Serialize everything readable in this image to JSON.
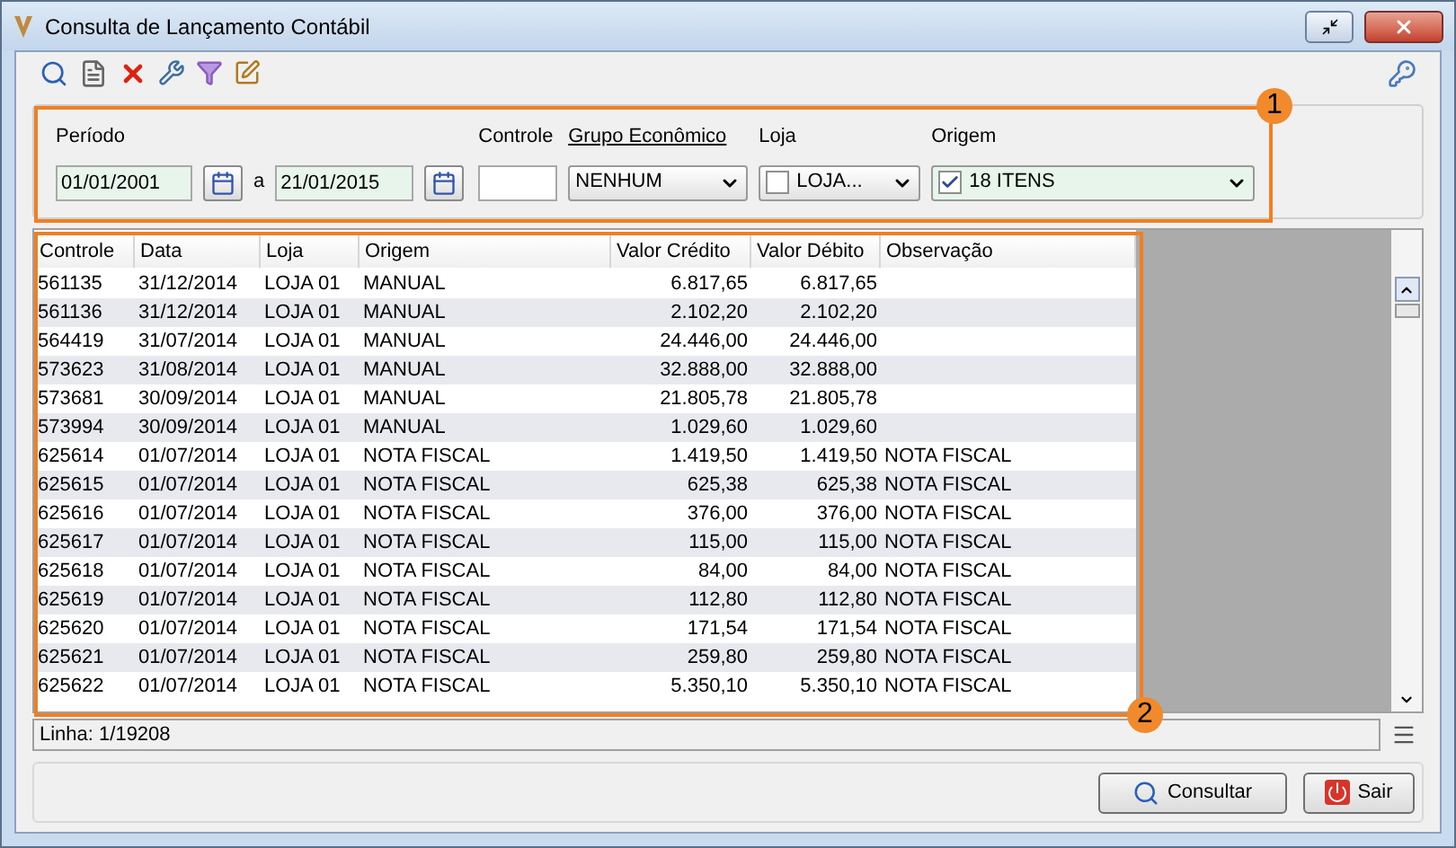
{
  "window": {
    "title": "Consulta de Lançamento Contábil"
  },
  "filters": {
    "period": {
      "label": "Período",
      "from": "01/01/2001",
      "separator": "a",
      "to": "21/01/2015"
    },
    "controle": {
      "label": "Controle"
    },
    "grupo": {
      "label": "Grupo Econômico",
      "value": "NENHUM"
    },
    "loja": {
      "label": "Loja",
      "checked": false,
      "value": "LOJA..."
    },
    "origem": {
      "label": "Origem",
      "checked": true,
      "value": "18 ITENS"
    }
  },
  "table": {
    "columns": [
      "Controle",
      "Data",
      "Loja",
      "Origem",
      "Valor Crédito",
      "Valor Débito",
      "Observação"
    ],
    "rows": [
      [
        "561135",
        "31/12/2014",
        "LOJA 01",
        "MANUAL",
        "6.817,65",
        "6.817,65",
        ""
      ],
      [
        "561136",
        "31/12/2014",
        "LOJA 01",
        "MANUAL",
        "2.102,20",
        "2.102,20",
        ""
      ],
      [
        "564419",
        "31/07/2014",
        "LOJA 01",
        "MANUAL",
        "24.446,00",
        "24.446,00",
        ""
      ],
      [
        "573623",
        "31/08/2014",
        "LOJA 01",
        "MANUAL",
        "32.888,00",
        "32.888,00",
        ""
      ],
      [
        "573681",
        "30/09/2014",
        "LOJA 01",
        "MANUAL",
        "21.805,78",
        "21.805,78",
        ""
      ],
      [
        "573994",
        "30/09/2014",
        "LOJA 01",
        "MANUAL",
        "1.029,60",
        "1.029,60",
        ""
      ],
      [
        "625614",
        "01/07/2014",
        "LOJA 01",
        "NOTA FISCAL",
        "1.419,50",
        "1.419,50",
        "NOTA FISCAL"
      ],
      [
        "625615",
        "01/07/2014",
        "LOJA 01",
        "NOTA FISCAL",
        "625,38",
        "625,38",
        "NOTA FISCAL"
      ],
      [
        "625616",
        "01/07/2014",
        "LOJA 01",
        "NOTA FISCAL",
        "376,00",
        "376,00",
        "NOTA FISCAL"
      ],
      [
        "625617",
        "01/07/2014",
        "LOJA 01",
        "NOTA FISCAL",
        "115,00",
        "115,00",
        "NOTA FISCAL"
      ],
      [
        "625618",
        "01/07/2014",
        "LOJA 01",
        "NOTA FISCAL",
        "84,00",
        "84,00",
        "NOTA FISCAL"
      ],
      [
        "625619",
        "01/07/2014",
        "LOJA 01",
        "NOTA FISCAL",
        "112,80",
        "112,80",
        "NOTA FISCAL"
      ],
      [
        "625620",
        "01/07/2014",
        "LOJA 01",
        "NOTA FISCAL",
        "171,54",
        "171,54",
        "NOTA FISCAL"
      ],
      [
        "625621",
        "01/07/2014",
        "LOJA 01",
        "NOTA FISCAL",
        "259,80",
        "259,80",
        "NOTA FISCAL"
      ],
      [
        "625622",
        "01/07/2014",
        "LOJA 01",
        "NOTA FISCAL",
        "5.350,10",
        "5.350,10",
        "NOTA FISCAL"
      ]
    ]
  },
  "status_bar": {
    "text": "Linha: 1/19208"
  },
  "buttons": [
    {
      "kind": "search",
      "label": "Consultar"
    },
    {
      "kind": "exit",
      "label": "Sair"
    }
  ],
  "annotations": [
    {
      "label": "1"
    },
    {
      "label": "2"
    }
  ]
}
